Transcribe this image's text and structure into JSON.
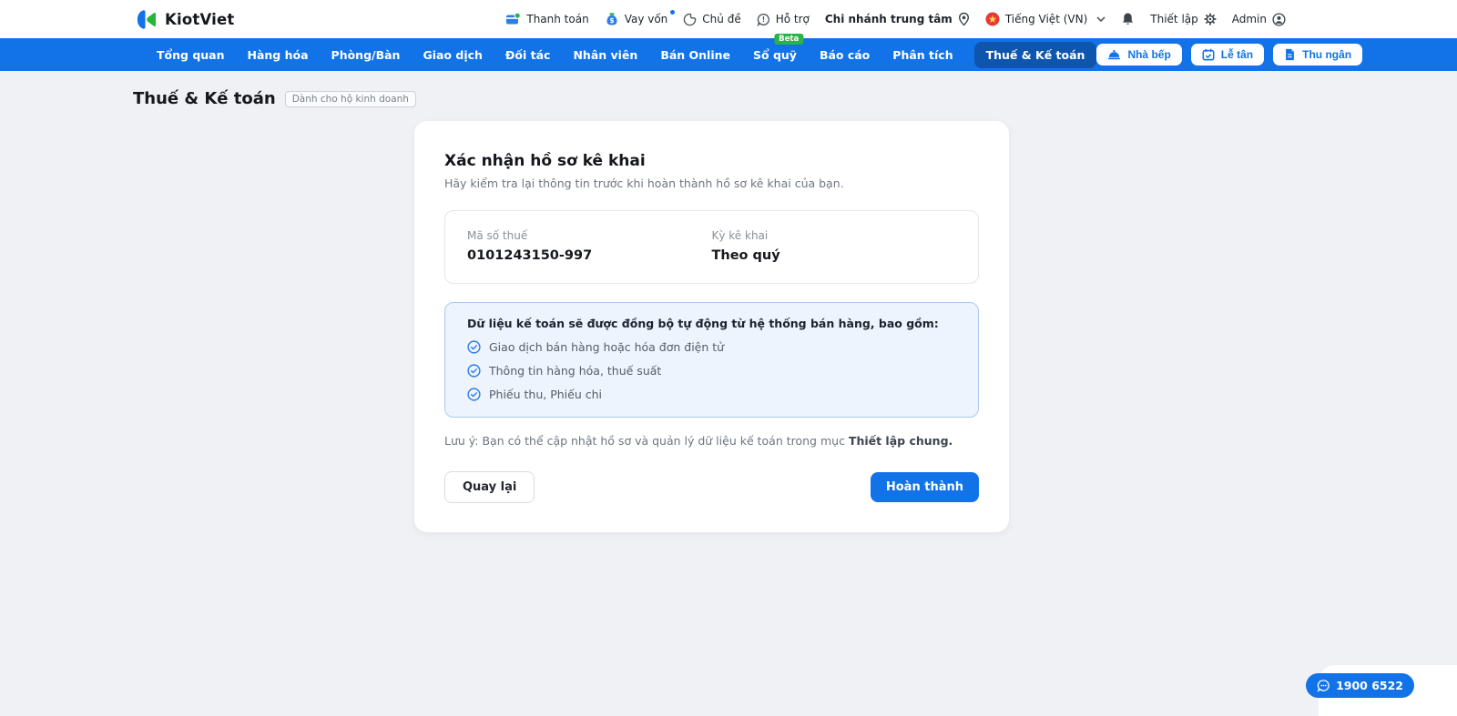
{
  "topbar": {
    "brand": "KiotViet",
    "menu": [
      {
        "label": "Thanh toán",
        "icon": "payment-icon"
      },
      {
        "label": "Vay vốn",
        "icon": "loan-icon",
        "notification_dot": true
      },
      {
        "label": "Chủ đề",
        "icon": "theme-icon"
      },
      {
        "label": "Hỗ trợ",
        "icon": "support-icon",
        "badge": "Beta"
      }
    ],
    "branch": {
      "label": "Chi nhánh trung tâm",
      "icon": "location-pin-icon"
    },
    "language": {
      "label": "Tiếng Việt (VN)",
      "icon": "vietnam-flag-icon",
      "caret": "chevron-down-icon"
    },
    "notifications": {
      "icon": "bell-icon"
    },
    "settings": {
      "label": "Thiết lập",
      "icon": "gear-icon"
    },
    "account": {
      "label": "Admin",
      "icon": "user-icon"
    }
  },
  "navbar": {
    "items": [
      "Tổng quan",
      "Hàng hóa",
      "Phòng/Bàn",
      "Giao dịch",
      "Đối tác",
      "Nhân viên",
      "Bán Online",
      "Sổ quỹ",
      "Báo cáo",
      "Phân tích",
      "Thuế & Kế toán"
    ],
    "active_item": "Thuế & Kế toán",
    "actions": [
      {
        "label": "Nhà bếp",
        "icon": "kitchen-cloche-icon"
      },
      {
        "label": "Lễ tân",
        "icon": "reception-calendar-icon"
      },
      {
        "label": "Thu ngân",
        "icon": "cashier-receipt-icon"
      }
    ]
  },
  "page": {
    "title": "Thuế & Kế toán",
    "badge": "Dành cho hộ kinh doanh"
  },
  "dialog": {
    "title": "Xác nhận hồ sơ kê khai",
    "subtitle": "Hãy kiểm tra lại thông tin trước khi hoàn thành hồ sơ kê khai của bạn.",
    "summary": {
      "fields": [
        {
          "label": "Mã số thuế",
          "value": "0101243150-997"
        },
        {
          "label": "Kỳ kê khai",
          "value": "Theo quý"
        }
      ]
    },
    "sync_info": {
      "heading": "Dữ liệu kế toán sẽ được đồng bộ tự động từ hệ thống bán hàng, bao gồm:",
      "item_icon": "check-circle-icon",
      "items": [
        "Giao dịch bán hàng hoặc hóa đơn điện tử",
        "Thông tin hàng hóa, thuế suất",
        "Phiếu thu, Phiếu chi"
      ]
    },
    "note": {
      "text": "Lưu ý: Bạn có thể cập nhật hồ sơ và quản lý dữ liệu kế toán trong mục ",
      "emphasis": "Thiết lập chung."
    },
    "buttons": {
      "back": "Quay lại",
      "submit": "Hoàn thành"
    }
  },
  "support_hotline": {
    "label": "1900 6522",
    "icon": "chat-bubble-icon"
  },
  "colors": {
    "primary_blue": "#1273e8",
    "nav_active_blue": "#0d55ad",
    "beta_green": "#28b446",
    "logo_green": "#27b53c",
    "flag_red": "#e53935",
    "flag_star_yellow": "#ffd54f",
    "info_box_bg": "#edf4fd",
    "info_box_border": "#abc9f3",
    "page_bg": "#f0f1f4",
    "text_dark": "#15171c",
    "text_gray": "#6f7680"
  }
}
